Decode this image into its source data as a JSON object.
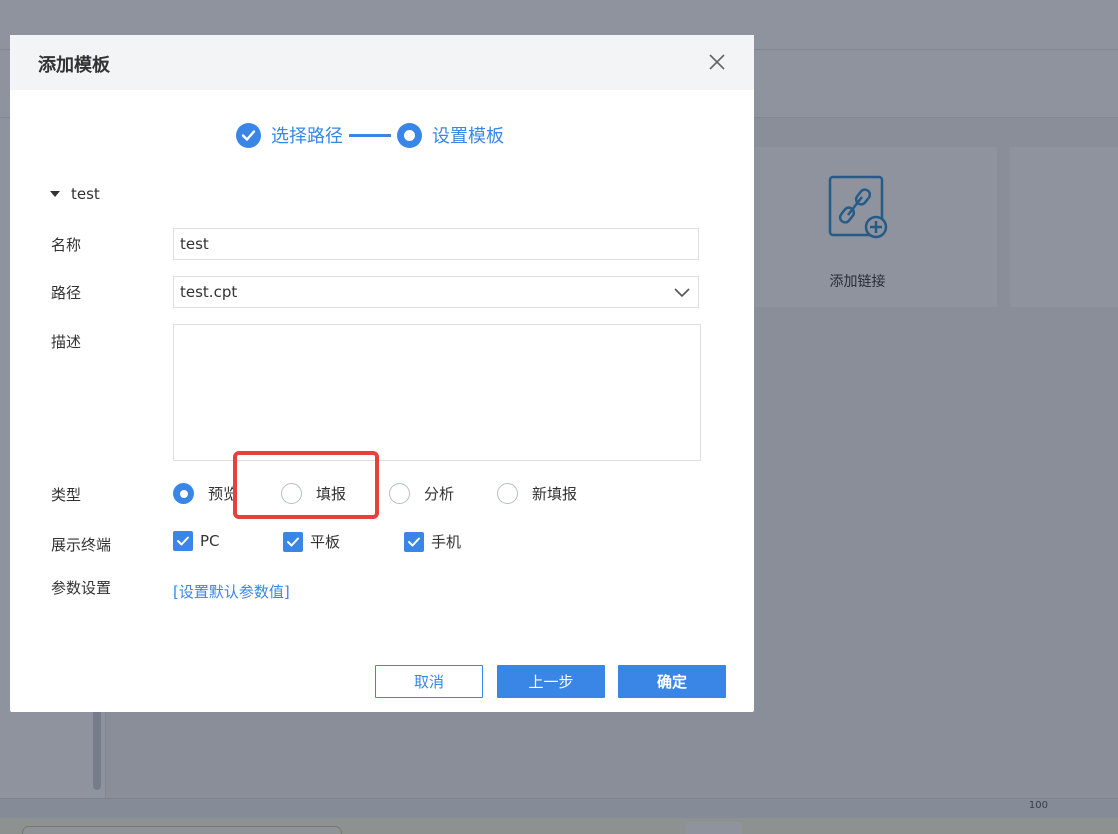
{
  "background": {
    "card_label": "添加链接",
    "zoom": "100"
  },
  "dialog": {
    "title": "添加模板",
    "steps": [
      {
        "label": "选择路径",
        "state": "done"
      },
      {
        "label": "设置模板",
        "state": "current"
      }
    ],
    "group_label": "test",
    "form": {
      "name_label": "名称",
      "name_value": "test",
      "path_label": "路径",
      "path_value": "test.cpt",
      "desc_label": "描述",
      "desc_value": "",
      "type_label": "类型",
      "type_options": [
        "预览",
        "填报",
        "分析",
        "新填报"
      ],
      "type_selected": "预览",
      "terminal_label": "展示终端",
      "terminal_options": [
        "PC",
        "平板",
        "手机"
      ],
      "param_label": "参数设置",
      "param_link": "[设置默认参数值]"
    },
    "buttons": {
      "cancel": "取消",
      "prev": "上一步",
      "ok": "确定"
    }
  },
  "colors": {
    "accent": "#3a86e6",
    "highlight": "#e8403a"
  }
}
